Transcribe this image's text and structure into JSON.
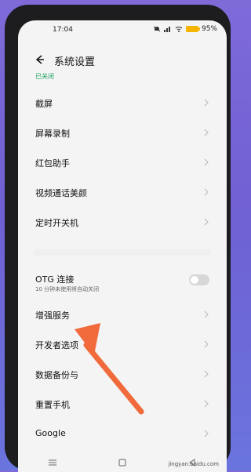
{
  "status_bar": {
    "time": "17:04",
    "battery_text": "95%",
    "battery_color": "#f6b300",
    "icons": [
      "wifi-icon",
      "signal-icon",
      "bell-off-icon"
    ]
  },
  "header": {
    "back_icon": "arrow-left",
    "title": "系统设置"
  },
  "status_text": "已关闭",
  "section1": [
    {
      "label": "截屏"
    },
    {
      "label": "屏幕录制"
    },
    {
      "label": "红包助手"
    },
    {
      "label": "视频通话美颜"
    },
    {
      "label": "定时开关机"
    }
  ],
  "otg": {
    "label": "OTG 连接",
    "subtitle": "10 分钟未使用将自动关闭",
    "toggle_on": false
  },
  "section2": [
    {
      "label": "增强服务"
    },
    {
      "label": "开发者选项"
    },
    {
      "label": "数据备份与"
    },
    {
      "label": "重置手机"
    },
    {
      "label": "Google"
    }
  ],
  "watermark": "jingyan.baidu.com",
  "annotation": {
    "color": "#f06a3b"
  },
  "gesture_bar": {
    "items": [
      "menu-icon",
      "home-icon",
      "back-icon"
    ]
  }
}
